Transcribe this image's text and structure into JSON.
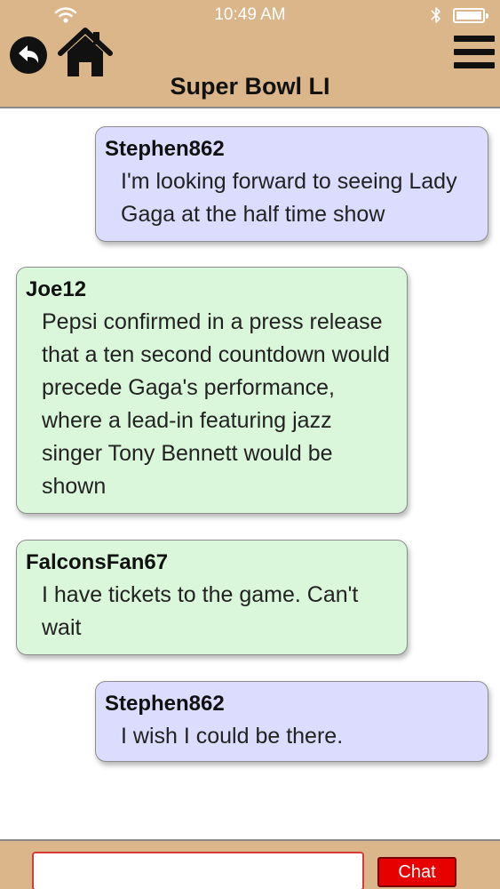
{
  "status_bar": {
    "time": "10:49 AM"
  },
  "header": {
    "title": "Super Bowl LI",
    "back_icon": "back-arrow-icon",
    "home_icon": "home-icon",
    "menu_icon": "hamburger-menu-icon"
  },
  "messages": [
    {
      "sender": "Stephen862",
      "text": "I'm looking forward to seeing Lady Gaga at the half time show",
      "side": "right"
    },
    {
      "sender": "Joe12",
      "text": "Pepsi confirmed in a press release that a ten second countdown would precede Gaga's performance, where a lead-in featuring jazz singer Tony Bennett would be shown",
      "side": "left"
    },
    {
      "sender": "FalconsFan67",
      "text": "I have tickets to the game. Can't wait",
      "side": "left"
    },
    {
      "sender": "Stephen862",
      "text": "I wish I could be there.",
      "side": "right"
    }
  ],
  "footer": {
    "input_value": "",
    "chat_button_label": "Chat"
  },
  "colors": {
    "header_bg": "#dab68a",
    "my_bubble": "#dcdcff",
    "other_bubble": "#dbf7db",
    "chat_button": "#e60000",
    "input_border": "#d83a3a"
  }
}
